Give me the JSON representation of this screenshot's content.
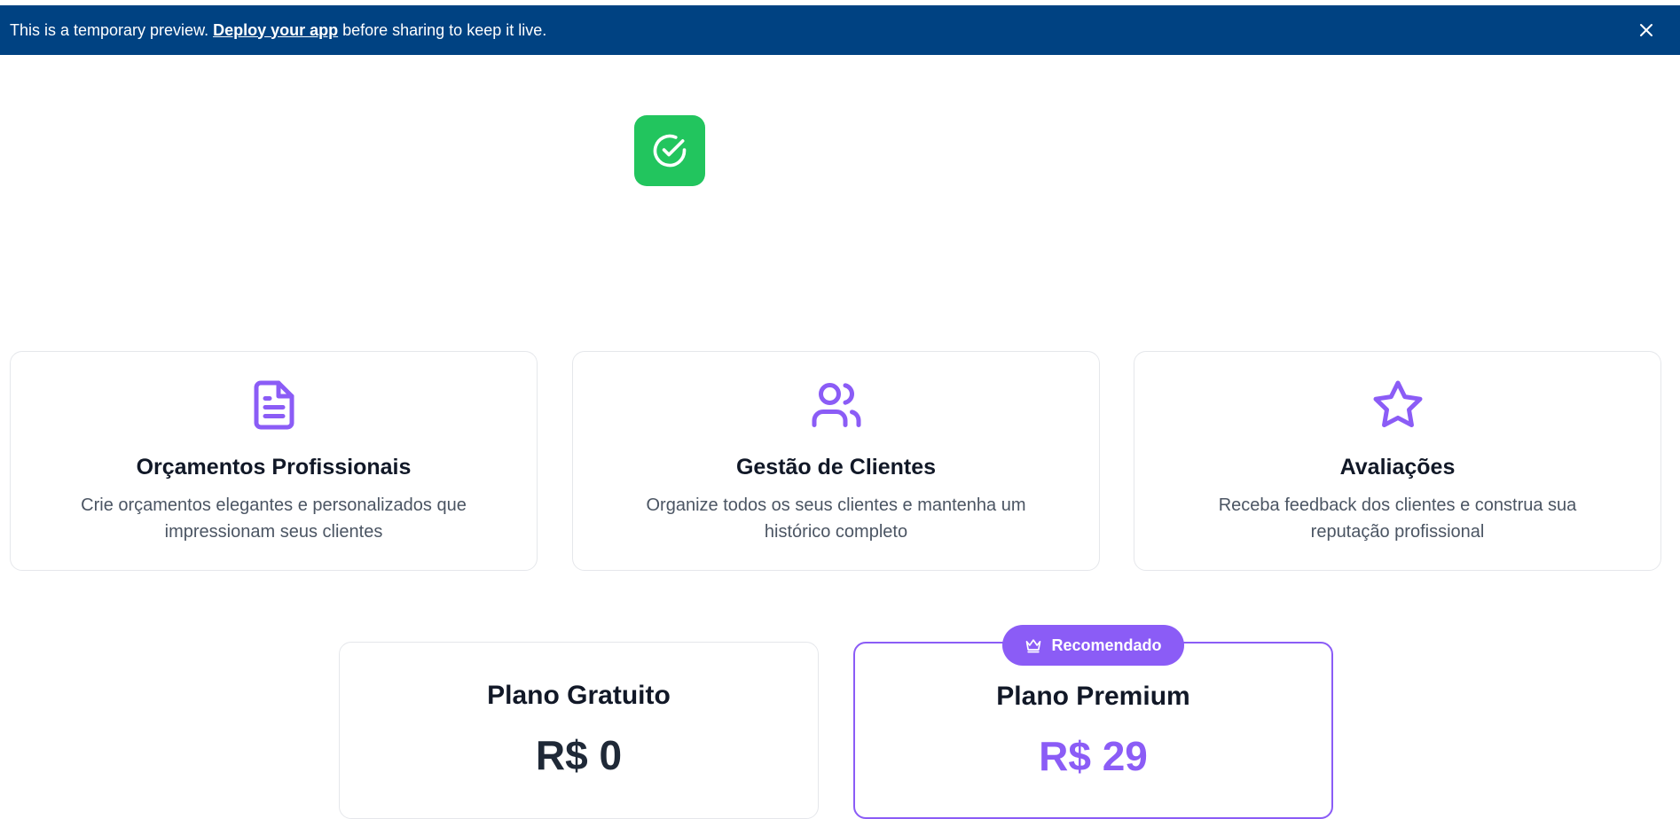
{
  "banner": {
    "prefix": "This is a temporary preview.",
    "link": "Deploy your app",
    "suffix": "before sharing to keep it live.",
    "close_icon": "close-icon"
  },
  "logo": {
    "icon": "check-circle-icon",
    "color": "#22c55e"
  },
  "features": [
    {
      "icon": "document-icon",
      "title": "Orçamentos Profissionais",
      "description": "Crie orçamentos elegantes e personalizados que impressionam seus clientes"
    },
    {
      "icon": "users-icon",
      "title": "Gestão de Clientes",
      "description": "Organize todos os seus clientes e mantenha um histórico completo"
    },
    {
      "icon": "star-icon",
      "title": "Avaliações",
      "description": "Receba feedback dos clientes e construa sua reputação profissional"
    }
  ],
  "plans": [
    {
      "title": "Plano Gratuito",
      "price": "R$ 0"
    },
    {
      "title": "Plano Premium",
      "price": "R$ 29",
      "badge": "Recomendado",
      "badge_icon": "crown-icon"
    }
  ],
  "colors": {
    "banner": "#004282",
    "accent": "#8b5cf6",
    "success": "#22c55e"
  }
}
